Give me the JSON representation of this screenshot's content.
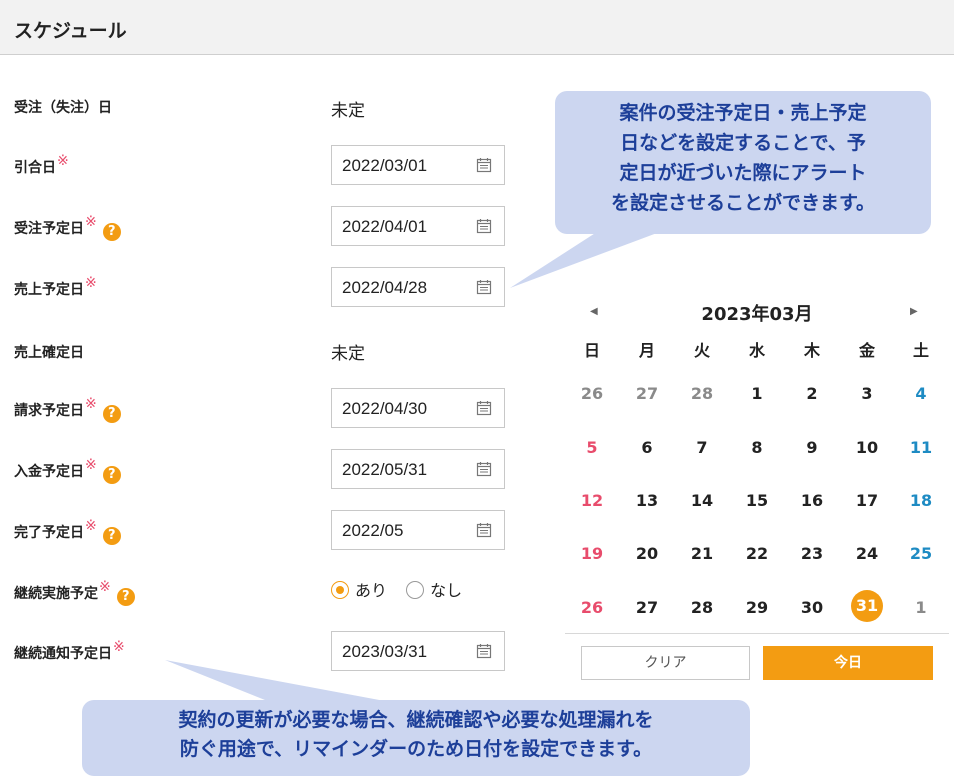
{
  "header": {
    "title": "スケジュール"
  },
  "rows": {
    "order_date": {
      "label": "受注（失注）日",
      "value": "未定"
    },
    "handover_date": {
      "label": "引合日",
      "value": "2022/03/01"
    },
    "order_plan": {
      "label": "受注予定日",
      "value": "2022/04/01"
    },
    "sales_plan": {
      "label": "売上予定日",
      "value": "2022/04/28"
    },
    "sales_confirm": {
      "label": "売上確定日",
      "value": "未定"
    },
    "billing_plan": {
      "label": "請求予定日",
      "value": "2022/04/30"
    },
    "payment_plan": {
      "label": "入金予定日",
      "value": "2022/05/31"
    },
    "complete_plan": {
      "label": "完了予定日",
      "value": "2022/05"
    },
    "continue_plan": {
      "label": "継続実施予定",
      "option_yes": "あり",
      "option_no": "なし",
      "selected": "あり"
    },
    "continue_notice": {
      "label": "継続通知予定日",
      "value": "2023/03/31"
    }
  },
  "required_mark": "※",
  "help_mark": "?",
  "calendar": {
    "title": "2023年03月",
    "prev": "◀",
    "next": "▶",
    "weekdays": [
      "日",
      "月",
      "火",
      "水",
      "木",
      "金",
      "土"
    ],
    "weeks": [
      [
        "26",
        "27",
        "28",
        "1",
        "2",
        "3",
        "4"
      ],
      [
        "5",
        "6",
        "7",
        "8",
        "9",
        "10",
        "11"
      ],
      [
        "12",
        "13",
        "14",
        "15",
        "16",
        "17",
        "18"
      ],
      [
        "19",
        "20",
        "21",
        "22",
        "23",
        "24",
        "25"
      ],
      [
        "26",
        "27",
        "28",
        "29",
        "30",
        "31",
        "1"
      ]
    ],
    "selected_day": "31",
    "clear_label": "クリア",
    "today_label": "今日"
  },
  "callouts": {
    "top": [
      "案件の受注予定日・売上予定",
      "日などを設定することで、予",
      "定日が近づいた際にアラート",
      "を設定させることができます。"
    ],
    "bottom": [
      "契約の更新が必要な場合、継続確認や必要な処理漏れを",
      "防ぐ用途で、リマインダーのため日付を設定できます。"
    ]
  },
  "colors": {
    "accent": "#f39c12",
    "required": "#e84c6c",
    "saturday": "#1e8bc3",
    "callout_bg": "#ccd6f0",
    "callout_text": "#1d3f99"
  }
}
